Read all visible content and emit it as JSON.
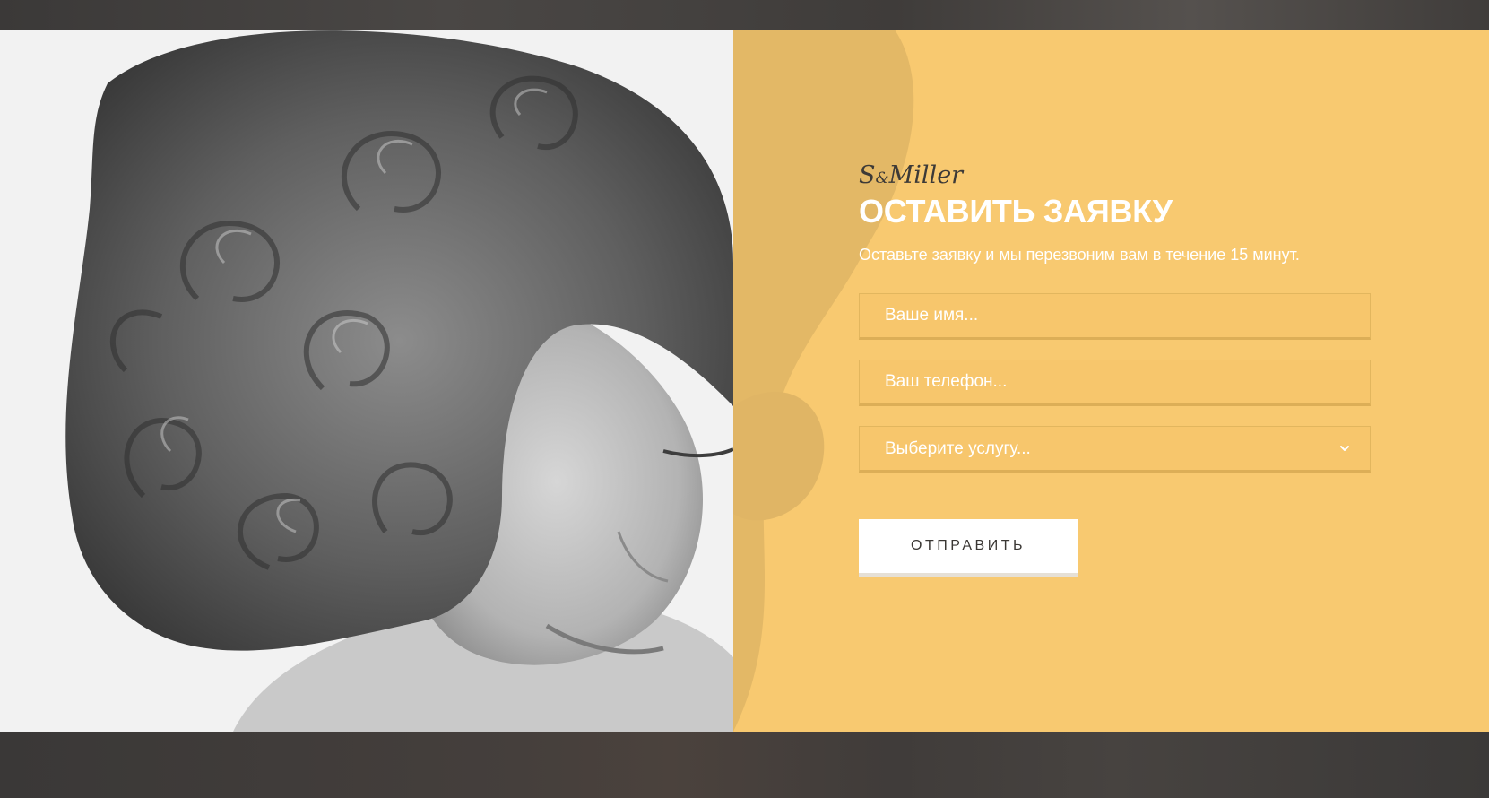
{
  "brand": {
    "logo_left": "S",
    "logo_amp": "&",
    "logo_right": "Miller"
  },
  "form": {
    "title": "ОСТАВИТЬ ЗАЯВКУ",
    "subtitle": "Оставьте заявку и мы перезвоним вам в течение 15 минут.",
    "name_placeholder": "Ваше имя...",
    "phone_placeholder": "Ваш телефон...",
    "service_placeholder": "Выберите услугу...",
    "submit_label": "ОТПРАВИТЬ"
  },
  "colors": {
    "accent": "#f8c970",
    "page_bg": "#3f3d3c",
    "button_bg": "#ffffff",
    "button_text": "#3a3734"
  },
  "icons": {
    "select_arrow": "chevron-down-icon"
  }
}
